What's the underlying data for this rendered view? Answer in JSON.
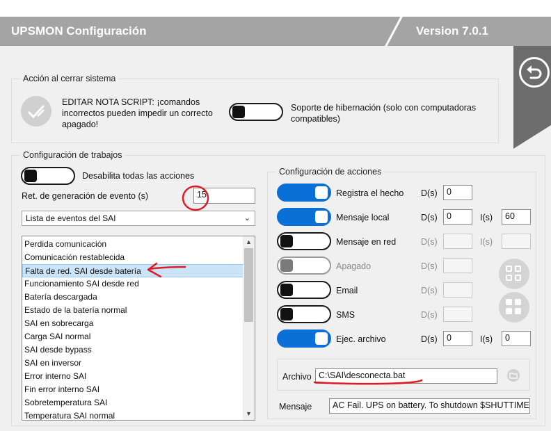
{
  "header": {
    "title": "UPSMON Configuración",
    "version": "Version 7.0.1"
  },
  "shutdown_action": {
    "legend": "Acción al cerrar sistema",
    "edit_note": "EDITAR NOTA SCRIPT: ¡comandos incorrectos pueden impedir un correcto apagado!",
    "edit_note_lines": [
      "EDITAR NOTA SCRIPT: ¡comandos",
      "incorrectos pueden impedir un correcto",
      "apagado!"
    ],
    "hibernation_label_lines": [
      "Soporte de hibernación (solo con computadoras",
      "compatibles)"
    ],
    "hibernation_on": false
  },
  "jobs": {
    "legend": "Configuración de trabajos",
    "disable_all_label": "Desabilita todas las acciones",
    "disable_all_on": false,
    "event_delay_label": "Ret. de generación de evento (s)",
    "event_delay_value": "15",
    "event_list_select": "Lista de eventos del SAI",
    "events": [
      "Perdida comunicación",
      "Comunicación restablecida",
      "Falta de red. SAI desde batería",
      "Funcionamiento SAI desde red",
      "Batería descargada",
      "Estado de la batería normal",
      "SAI en sobrecarga",
      "Carga SAI normal",
      "SAI desde bypass",
      "SAI en inversor",
      "Error interno SAI",
      "Fin error interno SAI",
      "Sobretemperatura SAI",
      "Temperatura SAI normal"
    ],
    "selected_event": "Falta de red. SAI desde batería"
  },
  "actions": {
    "legend": "Configuración de acciones",
    "d_label": "D(s)",
    "i_label": "I(s)",
    "rows": [
      {
        "label": "Registra el hecho",
        "state": "on",
        "d": "0",
        "i": null
      },
      {
        "label": "Mensaje local",
        "state": "on",
        "d": "0",
        "i": "60"
      },
      {
        "label": "Mensaje en red",
        "state": "off",
        "d": "",
        "i": ""
      },
      {
        "label": "Apagado",
        "state": "disabled",
        "d": "",
        "i": null
      },
      {
        "label": "Email",
        "state": "off",
        "d": "",
        "i": null
      },
      {
        "label": "SMS",
        "state": "off",
        "d": "",
        "i": null
      },
      {
        "label": "Ejec. archivo",
        "state": "on",
        "d": "0",
        "i": "0"
      }
    ],
    "archivo_label": "Archivo",
    "archivo_value": "C:\\SAI\\desconecta.bat",
    "mensaje_label": "Mensaje",
    "mensaje_value": "AC Fail. UPS on battery. To shutdown $SHUTTIME"
  },
  "icons": {
    "back": "undo-arrow-icon",
    "edit": "check-pencil-icon",
    "grid": "grid-icon",
    "folder": "folder-icon"
  },
  "colors": {
    "toggle_on": "#0a6fd6",
    "header_bg": "#a4a4a4",
    "selection_bg": "#cce4f7",
    "annotation_red": "#e01b24"
  }
}
